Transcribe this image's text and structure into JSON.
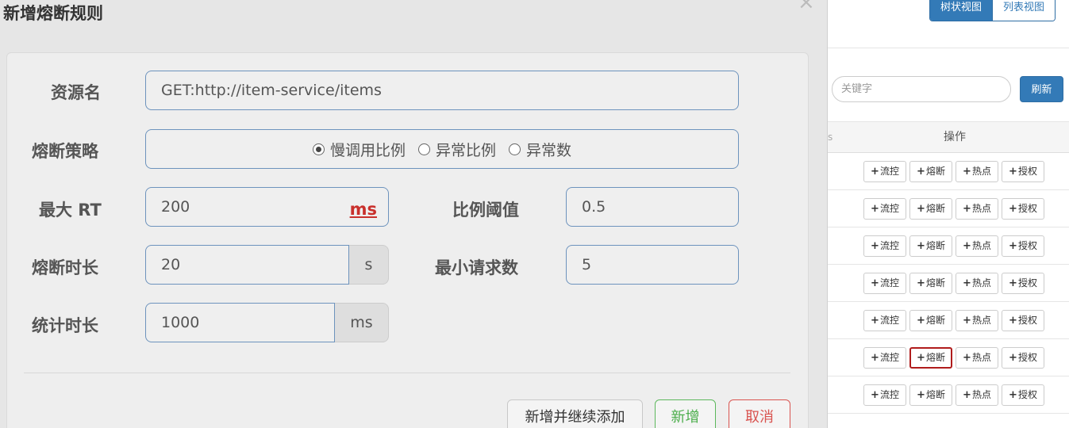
{
  "modal": {
    "title": "新增熔断规则",
    "close_icon": "×",
    "form": {
      "resource_label": "资源名",
      "resource_value": "GET:http://item-service/items",
      "strategy_label": "熔断策略",
      "strategy_options": [
        {
          "label": "慢调用比例",
          "selected": true
        },
        {
          "label": "异常比例",
          "selected": false
        },
        {
          "label": "异常数",
          "selected": false
        }
      ],
      "max_rt_label": "最大 RT",
      "max_rt_value": "200",
      "max_rt_unit": "ms",
      "ratio_label": "比例阈值",
      "ratio_value": "0.5",
      "break_duration_label": "熔断时长",
      "break_duration_value": "20",
      "break_duration_unit": "s",
      "min_request_label": "最小请求数",
      "min_request_value": "5",
      "stat_duration_label": "统计时长",
      "stat_duration_value": "1000",
      "stat_duration_unit": "ms"
    },
    "footer": {
      "continue_label": "新增并继续添加",
      "add_label": "新增",
      "cancel_label": "取消"
    }
  },
  "background": {
    "view_tabs": [
      "树状视图",
      "列表视图"
    ],
    "search_placeholder": "关键字",
    "refresh_label": "刷新",
    "column_fragment": "s",
    "operations_header": "操作",
    "row_actions": [
      "流控",
      "熔断",
      "热点",
      "授权"
    ],
    "row_count": 7,
    "highlighted_row": 5,
    "highlighted_action": "熔断"
  },
  "colors": {
    "primary": "#337ab7",
    "success": "#5cb85c",
    "danger": "#d9534f",
    "highlight_border": "#b01c1c"
  }
}
